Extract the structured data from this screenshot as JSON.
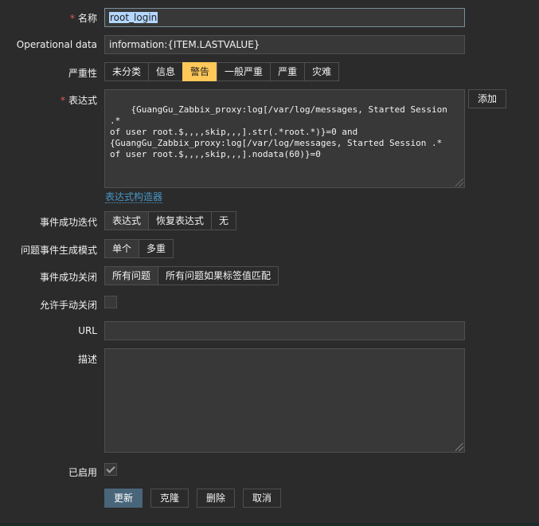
{
  "form": {
    "name": {
      "label": "名称",
      "value": "root_login"
    },
    "opdata": {
      "label": "Operational data",
      "value": "information:{ITEM.LASTVALUE}"
    },
    "severity": {
      "label": "严重性",
      "options": [
        "未分类",
        "信息",
        "警告",
        "一般严重",
        "严重",
        "灾难"
      ],
      "selected": "警告"
    },
    "expression": {
      "label": "表达式",
      "value": "{GuangGu_Zabbix_proxy:log[/var/log/messages, Started Session .*\nof user root.$,,,,skip,,,].str(.*root.*)}=0 and\n{GuangGu_Zabbix_proxy:log[/var/log/messages, Started Session .*\nof user root.$,,,,skip,,,].nodata(60)}=0",
      "add_button": "添加",
      "builder_link": "表达式构造器"
    },
    "ok_event": {
      "label": "事件成功迭代",
      "options": [
        "表达式",
        "恢复表达式",
        "无"
      ],
      "selected": "表达式"
    },
    "problem_mode": {
      "label": "问题事件生成模式",
      "options": [
        "单个",
        "多重"
      ],
      "selected": "单个"
    },
    "ok_close": {
      "label": "事件成功关闭",
      "options": [
        "所有问题",
        "所有问题如果标签值匹配"
      ],
      "selected": "所有问题"
    },
    "manual_close": {
      "label": "允许手动关闭",
      "checked": false
    },
    "url": {
      "label": "URL",
      "value": ""
    },
    "description": {
      "label": "描述",
      "value": ""
    },
    "enabled": {
      "label": "已启用",
      "checked": true
    }
  },
  "actions": {
    "update": "更新",
    "clone": "克隆",
    "delete": "删除",
    "cancel": "取消"
  },
  "colors": {
    "background": "#2b2b2b",
    "field": "#383838",
    "warning": "#ffc859",
    "required": "#e45959",
    "link": "#4796c4",
    "primary": "#48657a"
  }
}
